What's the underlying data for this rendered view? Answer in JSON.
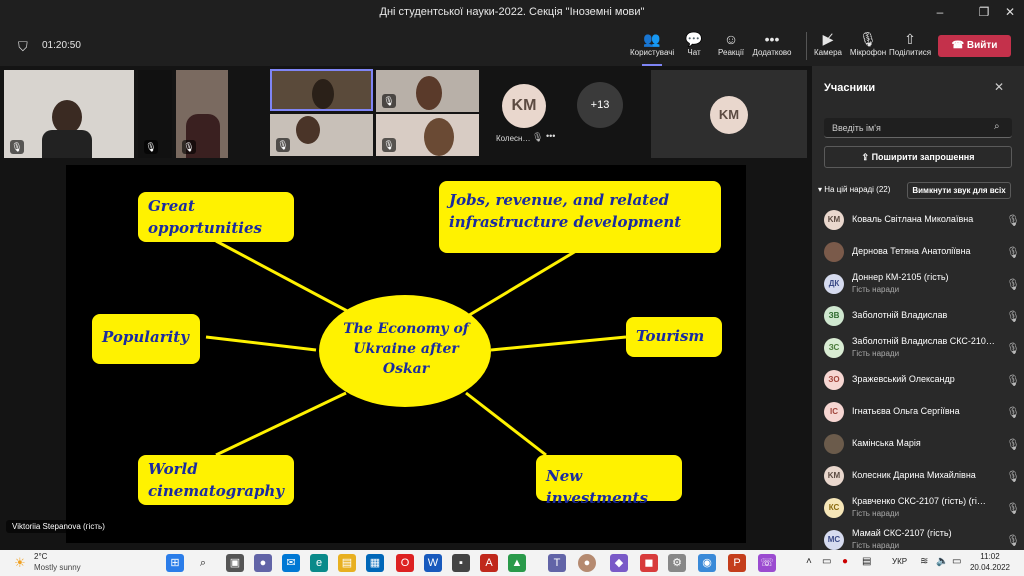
{
  "window": {
    "title": "Дні студентської науки-2022. Секція \"Іноземні мови\""
  },
  "toolbar": {
    "timer": "01:20:50",
    "people_label": "Користувачі",
    "chat_label": "Чат",
    "reactions_label": "Реакції",
    "more_label": "Додатково",
    "camera_label": "Камера",
    "mic_label": "Мікрофон",
    "share_label": "Поділитися",
    "leave_label": "Вийти"
  },
  "video_strip": {
    "initials": "KM",
    "overflow_count": "+13",
    "small_name": "Колесн…",
    "large_initials": "KM"
  },
  "slide": {
    "center": "The Economy of Ukraine after Oskar",
    "great": "Great opportunities",
    "jobs": "Jobs, revenue, and related infrastructure development",
    "popularity": "Popularity",
    "tourism": "Tourism",
    "world": "World cinematography",
    "investments": "New investments",
    "colors": {
      "box": "#fff200",
      "text": "#1a2ba0",
      "line": "#fff200"
    }
  },
  "presenter_label": "Viktoriia Stepanova (гість)",
  "sidebar": {
    "title": "Учасники",
    "search_placeholder": "Введіть ім'я",
    "invite_label": "Поширити запрошення",
    "section_label": "На цій нараді (22)",
    "mute_all_label": "Вимкнути звук для всіх",
    "participants": [
      {
        "initials": "KM",
        "name": "Коваль Світлана Миколаївна",
        "sub": "",
        "bg": "#e9d7cd",
        "fg": "#5c4b42"
      },
      {
        "initials": "",
        "name": "Дернова Тетяна Анатоліївна",
        "sub": "",
        "bg": "#7a5a4a",
        "fg": "#fff"
      },
      {
        "initials": "ДК",
        "name": "Доннер КМ-2105 (гість)",
        "sub": "Гість наради",
        "bg": "#d6dbef",
        "fg": "#3b4a86"
      },
      {
        "initials": "ЗВ",
        "name": "Заболотній Владислав",
        "sub": "",
        "bg": "#cfe7cf",
        "fg": "#2f6b2f"
      },
      {
        "initials": "ЗС",
        "name": "Заболотній Владислав СКС-210…",
        "sub": "Гість наради",
        "bg": "#d9ecd3",
        "fg": "#4a7a3a"
      },
      {
        "initials": "ЗО",
        "name": "Зражевський Олександр",
        "sub": "",
        "bg": "#f6d6d2",
        "fg": "#a0443a"
      },
      {
        "initials": "ІС",
        "name": "Ігнатьєва Ольга Сергіївна",
        "sub": "",
        "bg": "#f6d6d2",
        "fg": "#a0443a"
      },
      {
        "initials": "",
        "name": "Камінська Марія",
        "sub": "",
        "bg": "#6b5b4b",
        "fg": "#fff"
      },
      {
        "initials": "KM",
        "name": "Колесник Дарина Михайлівна",
        "sub": "",
        "bg": "#e9d7cd",
        "fg": "#5c4b42"
      },
      {
        "initials": "КС",
        "name": "Кравченко СКС-2107 (гість) (гі…",
        "sub": "Гість наради",
        "bg": "#f6e6b8",
        "fg": "#8a6a10"
      },
      {
        "initials": "МС",
        "name": "Мамай СКС-2107 (гість)",
        "sub": "Гість наради",
        "bg": "#d6dbef",
        "fg": "#3b4a86"
      }
    ]
  },
  "taskbar": {
    "temp": "2°C",
    "weather": "Mostly sunny",
    "lang": "УКР",
    "time": "11:02",
    "date": "20.04.2022"
  }
}
